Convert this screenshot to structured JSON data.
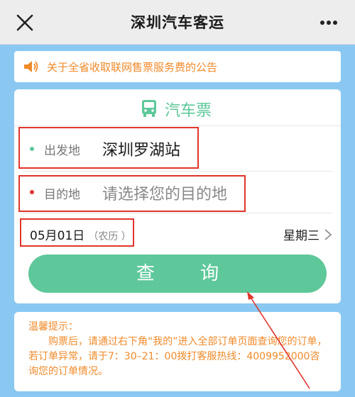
{
  "header": {
    "title": "深圳汽车客运"
  },
  "notice": {
    "text": "关于全省收取联网售票服务费的公告"
  },
  "ticket_card": {
    "title": "汽车票",
    "departure": {
      "label": "出发地",
      "value": "深圳罗湖站"
    },
    "destination": {
      "label": "目的地",
      "placeholder": "请选择您的目的地"
    },
    "date": {
      "value": "05月01日",
      "calendar": "（农历 ）"
    },
    "weekday": "星期三",
    "query_button": "查 询"
  },
  "tips": {
    "title": "温馨提示：",
    "body": "购票后，请通过右下角“我的”进入全部订单页面查询您的订单，若订单异常，请于7：30–21：00拨打客服热线：4009952000咨询您的订单情况。"
  },
  "colors": {
    "accent_green": "#5ec89a",
    "notice_orange": "#f08a2a",
    "background_blue": "#8ac8f2",
    "annotation_red": "#e0352b"
  }
}
